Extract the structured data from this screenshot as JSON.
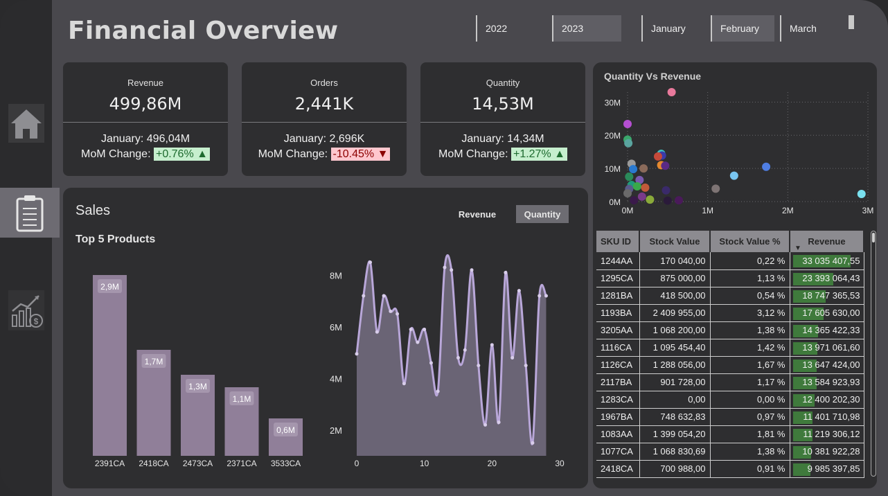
{
  "title": "Financial Overview",
  "slicers": {
    "years": [
      {
        "label": "2022",
        "selected": false
      },
      {
        "label": "2023",
        "selected": true
      }
    ],
    "months": [
      {
        "label": "January",
        "selected": false
      },
      {
        "label": "February",
        "selected": true
      },
      {
        "label": "March",
        "selected": false
      }
    ]
  },
  "nav": [
    {
      "icon": "home-icon",
      "active": false
    },
    {
      "icon": "clipboard-icon",
      "active": true
    },
    {
      "icon": "finance-chart-icon",
      "active": false
    }
  ],
  "kpis": [
    {
      "label": "Revenue",
      "value": "499,86M",
      "prev": "January: 496,04M",
      "mom_label": "MoM Change:",
      "mom": "+0.76% ▲",
      "trend": "up"
    },
    {
      "label": "Orders",
      "value": "2,441K",
      "prev": "January: 2,696K",
      "mom_label": "MoM Change:",
      "mom": "-10.45% ▼",
      "trend": "down"
    },
    {
      "label": "Quantity",
      "value": "14,53M",
      "prev": "January: 14,34M",
      "mom_label": "MoM Change:",
      "mom": "+1.27% ▲",
      "trend": "up"
    }
  ],
  "sales": {
    "title": "Sales",
    "subtitle": "Top 5 Products",
    "toggle": [
      {
        "label": "Revenue",
        "selected": false
      },
      {
        "label": "Quantity",
        "selected": true
      }
    ]
  },
  "scatter_title": "Quantity Vs Revenue",
  "table": {
    "columns": [
      "SKU ID",
      "Stock Value",
      "Stock Value %",
      "Revenue"
    ],
    "rows": [
      [
        "1244AA",
        "170 040,00",
        "0,22 %",
        "33 035 407,55"
      ],
      [
        "1295CA",
        "875 000,00",
        "1,13 %",
        "23 393 064,43"
      ],
      [
        "1281BA",
        "418 500,00",
        "0,54 %",
        "18 747 365,53"
      ],
      [
        "1193BA",
        "2 409 955,00",
        "3,12 %",
        "17 605 630,00"
      ],
      [
        "3205AA",
        "1 068 200,00",
        "1,38 %",
        "14 365 422,33"
      ],
      [
        "1116CA",
        "1 095 454,40",
        "1,42 %",
        "13 971 061,60"
      ],
      [
        "1126CA",
        "1 288 056,00",
        "1,67 %",
        "13 647 424,00"
      ],
      [
        "2117BA",
        "901 728,00",
        "1,17 %",
        "13 584 923,93"
      ],
      [
        "1283CA",
        "0,00",
        "0,00 %",
        "12 400 202,30"
      ],
      [
        "1967BA",
        "748 632,83",
        "0,97 %",
        "11 401 710,98"
      ],
      [
        "1083AA",
        "1 399 054,20",
        "1,81 %",
        "11 219 306,12"
      ],
      [
        "1077CA",
        "1 068 830,69",
        "1,38 %",
        "10 381 922,28"
      ],
      [
        "2418CA",
        "700 988,00",
        "0,91 %",
        "9 985 397,85"
      ]
    ],
    "revenue_values": [
      33035407.55,
      23393064.43,
      18747365.53,
      17605630.0,
      14365422.33,
      13971061.6,
      13647424.0,
      13584923.93,
      12400202.3,
      11401710.98,
      11219306.12,
      10381922.28,
      9985397.85
    ],
    "sort_indicator": "▼"
  },
  "colors": {
    "accent_bar": "#907f99",
    "line": "#b9a7d9",
    "area": "#6a6475",
    "up_bg": "#c6efce",
    "down_bg": "#ffc7ce",
    "data_bar": "#3f7a3c"
  },
  "chart_data": [
    {
      "type": "bar",
      "title": "Top 5 Products",
      "categories": [
        "2391CA",
        "2418CA",
        "2473CA",
        "2371CA",
        "3533CA"
      ],
      "values": [
        2.9,
        1.7,
        1.3,
        1.1,
        0.6
      ],
      "labels": [
        "2,9M",
        "1,7M",
        "1,3M",
        "1,1M",
        "0,6M"
      ],
      "unit": "M",
      "ylim": [
        0,
        3.2
      ]
    },
    {
      "type": "area",
      "x": [
        0,
        1,
        2,
        3,
        4,
        5,
        6,
        7,
        8,
        9,
        10,
        11,
        12,
        13,
        14,
        15,
        16,
        17,
        18,
        19,
        20,
        21,
        22,
        23,
        24,
        25,
        26,
        27,
        28
      ],
      "values": [
        4.95,
        7.2,
        8.5,
        5.8,
        7.2,
        6.6,
        6.5,
        3.8,
        5.9,
        5.4,
        5.9,
        4.6,
        3.5,
        8.3,
        8.2,
        4.8,
        5.1,
        8.2,
        4.5,
        2.2,
        5.3,
        2.3,
        8.1,
        4.8,
        7.4,
        4.5,
        1.5,
        7.2,
        7.2
      ],
      "xticks": [
        "0",
        "10",
        "20",
        "30"
      ],
      "yticks": [
        "2M",
        "4M",
        "6M",
        "8M"
      ],
      "xlim": [
        0,
        30
      ],
      "ylim": [
        1.0,
        9.0
      ]
    },
    {
      "type": "scatter",
      "title": "Quantity Vs Revenue",
      "xticks": [
        "0M",
        "1M",
        "2M",
        "3M"
      ],
      "yticks": [
        "0M",
        "10M",
        "20M",
        "30M"
      ],
      "xlim": [
        0,
        3
      ],
      "ylim": [
        0,
        33
      ],
      "grid": true,
      "points": [
        {
          "x": 0.55,
          "y": 33.0,
          "color": "#e8799b"
        },
        {
          "x": 0.0,
          "y": 23.4,
          "color": "#b54fd1"
        },
        {
          "x": 0.0,
          "y": 18.7,
          "color": "#3aa66b"
        },
        {
          "x": 0.01,
          "y": 17.6,
          "color": "#5aa49f"
        },
        {
          "x": 0.42,
          "y": 14.4,
          "color": "#3fbfc0"
        },
        {
          "x": 0.43,
          "y": 13.9,
          "color": "#3a3aa8"
        },
        {
          "x": 0.38,
          "y": 13.6,
          "color": "#c54a3a"
        },
        {
          "x": 0.05,
          "y": 11.4,
          "color": "#9a9a9a"
        },
        {
          "x": 0.42,
          "y": 11.0,
          "color": "#e5892f"
        },
        {
          "x": 0.47,
          "y": 10.8,
          "color": "#5a2a86"
        },
        {
          "x": 0.2,
          "y": 10.0,
          "color": "#8a6a5a"
        },
        {
          "x": 0.07,
          "y": 9.8,
          "color": "#2a7ad0"
        },
        {
          "x": 1.73,
          "y": 10.5,
          "color": "#4f7ee3"
        },
        {
          "x": 1.33,
          "y": 7.8,
          "color": "#79c5f0"
        },
        {
          "x": 0.02,
          "y": 7.5,
          "color": "#2a8a5a"
        },
        {
          "x": 0.15,
          "y": 6.5,
          "color": "#7a5ab0"
        },
        {
          "x": 0.05,
          "y": 5.0,
          "color": "#1f9a7a"
        },
        {
          "x": 0.12,
          "y": 4.6,
          "color": "#3aa84a"
        },
        {
          "x": 0.22,
          "y": 4.2,
          "color": "#c25a3a"
        },
        {
          "x": 0.02,
          "y": 3.8,
          "color": "#5a5a8a"
        },
        {
          "x": 0.48,
          "y": 3.4,
          "color": "#3a2a6a"
        },
        {
          "x": 1.1,
          "y": 3.9,
          "color": "#7e7474"
        },
        {
          "x": 2.92,
          "y": 2.3,
          "color": "#79e0ee"
        },
        {
          "x": 0.28,
          "y": 0.6,
          "color": "#8aaa3a"
        },
        {
          "x": 0.08,
          "y": 0.4,
          "color": "#3a1a4a"
        },
        {
          "x": 0.5,
          "y": 0.3,
          "color": "#2a1a3a"
        },
        {
          "x": 0.64,
          "y": 0.4,
          "color": "#4a1a5a"
        },
        {
          "x": 0.18,
          "y": 1.5,
          "color": "#7a3a8a"
        },
        {
          "x": 0.0,
          "y": 2.5,
          "color": "#6a6a6a"
        }
      ]
    }
  ]
}
